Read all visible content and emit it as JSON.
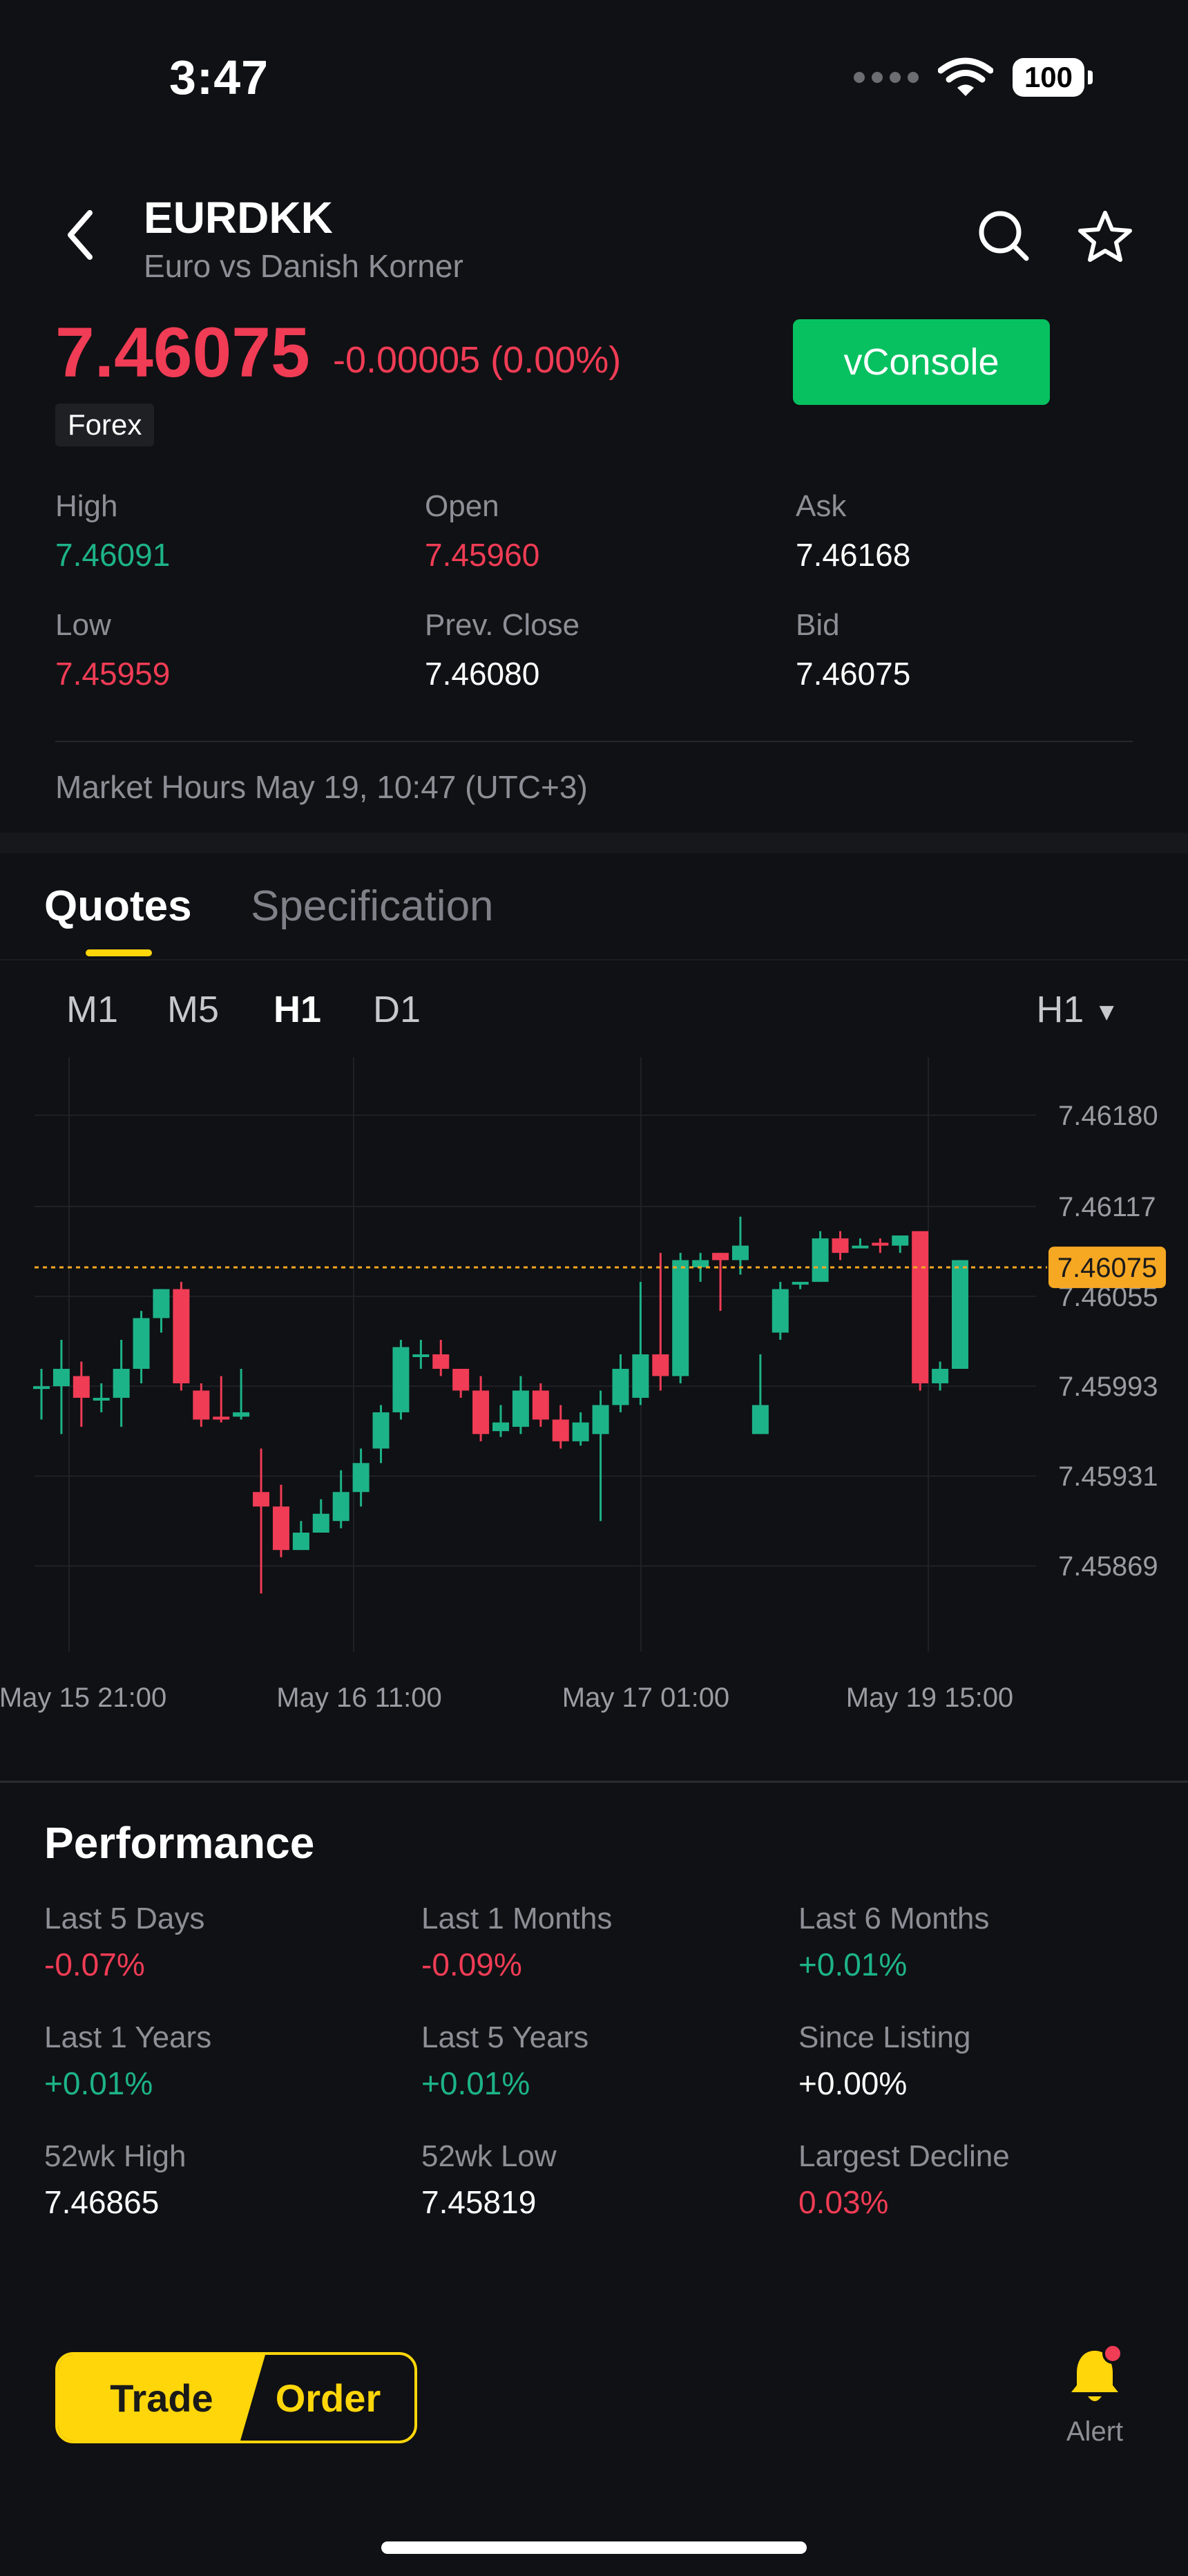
{
  "status_bar": {
    "time": "3:47",
    "battery": "100"
  },
  "header": {
    "symbol": "EURDKK",
    "subtitle": "Euro vs Danish Korner"
  },
  "quote": {
    "price": "7.46075",
    "change": "-0.00005 (0.00%)",
    "tag": "Forex",
    "vconsole_label": "vConsole"
  },
  "stats": [
    {
      "label": "High",
      "value": "7.46091",
      "tone": "green"
    },
    {
      "label": "Open",
      "value": "7.45960",
      "tone": "red"
    },
    {
      "label": "Ask",
      "value": "7.46168",
      "tone": "white"
    },
    {
      "label": "Low",
      "value": "7.45959",
      "tone": "red"
    },
    {
      "label": "Prev. Close",
      "value": "7.46080",
      "tone": "white"
    },
    {
      "label": "Bid",
      "value": "7.46075",
      "tone": "white"
    }
  ],
  "market_hours": "Market Hours May 19, 10:47 (UTC+3)",
  "tabs": [
    "Quotes",
    "Specification"
  ],
  "timeframes": [
    "M1",
    "M5",
    "H1",
    "D1"
  ],
  "active_timeframe": "H1",
  "timeframe_select": "H1",
  "chart_data": {
    "type": "candlestick",
    "y_ticks": [
      "7.46180",
      "7.46117",
      "7.46055",
      "7.45993",
      "7.45931",
      "7.45869"
    ],
    "x_ticks": [
      "May 15 21:00",
      "May 16 11:00",
      "May 17 01:00",
      "May 19 15:00"
    ],
    "current_price_label": "7.46075",
    "current_price": 7.46075,
    "ylim": [
      7.4581,
      7.4622
    ],
    "up_color": "#1db389",
    "down_color": "#f03c55",
    "candles": [
      [
        7.45993,
        7.45993,
        7.4597,
        7.46005
      ],
      [
        7.45993,
        7.46005,
        7.4596,
        7.46025
      ],
      [
        7.46,
        7.45985,
        7.45965,
        7.4601
      ],
      [
        7.45985,
        7.45985,
        7.45975,
        7.45995
      ],
      [
        7.45985,
        7.46005,
        7.45965,
        7.46025
      ],
      [
        7.46005,
        7.4604,
        7.45995,
        7.46045
      ],
      [
        7.4604,
        7.4606,
        7.4603,
        7.4606
      ],
      [
        7.4606,
        7.45995,
        7.4599,
        7.46065
      ],
      [
        7.4599,
        7.4597,
        7.45965,
        7.45995
      ],
      [
        7.45972,
        7.4597,
        7.45968,
        7.46
      ],
      [
        7.45972,
        7.45975,
        7.4597,
        7.46005
      ],
      [
        7.4592,
        7.4591,
        7.4585,
        7.4595
      ],
      [
        7.4591,
        7.4588,
        7.45875,
        7.45925
      ],
      [
        7.4588,
        7.45892,
        7.4588,
        7.459
      ],
      [
        7.45892,
        7.45905,
        7.45895,
        7.45915
      ],
      [
        7.459,
        7.4592,
        7.45895,
        7.45935
      ],
      [
        7.4592,
        7.4594,
        7.4591,
        7.4595
      ],
      [
        7.4595,
        7.45975,
        7.4594,
        7.4598
      ],
      [
        7.45975,
        7.4602,
        7.4597,
        7.46025
      ],
      [
        7.46015,
        7.46015,
        7.46005,
        7.46025
      ],
      [
        7.46015,
        7.46005,
        7.46,
        7.46025
      ],
      [
        7.46005,
        7.4599,
        7.45985,
        7.46005
      ],
      [
        7.4599,
        7.4596,
        7.45955,
        7.46
      ],
      [
        7.45962,
        7.45968,
        7.45958,
        7.4598
      ],
      [
        7.45965,
        7.4599,
        7.4596,
        7.46
      ],
      [
        7.4599,
        7.4597,
        7.45965,
        7.45995
      ],
      [
        7.4597,
        7.45955,
        7.4595,
        7.4598
      ],
      [
        7.45955,
        7.45968,
        7.45952,
        7.45975
      ],
      [
        7.4596,
        7.4598,
        7.459,
        7.4599
      ],
      [
        7.4598,
        7.46005,
        7.45975,
        7.46015
      ],
      [
        7.45985,
        7.46015,
        7.4598,
        7.46065
      ],
      [
        7.46015,
        7.46,
        7.4599,
        7.46085
      ],
      [
        7.46,
        7.4608,
        7.45995,
        7.46085
      ],
      [
        7.46075,
        7.4608,
        7.46065,
        7.46085
      ],
      [
        7.46085,
        7.4608,
        7.46045,
        7.46085
      ],
      [
        7.4608,
        7.4609,
        7.4607,
        7.4611
      ],
      [
        7.4596,
        7.4598,
        7.4596,
        7.46015
      ],
      [
        7.4603,
        7.4606,
        7.46025,
        7.46065
      ],
      [
        7.46065,
        7.46065,
        7.4606,
        7.46065
      ],
      [
        7.46065,
        7.46095,
        7.46065,
        7.461
      ],
      [
        7.46095,
        7.46085,
        7.4608,
        7.461
      ],
      [
        7.4609,
        7.4609,
        7.4609,
        7.46095
      ],
      [
        7.46092,
        7.4609,
        7.46085,
        7.46095
      ],
      [
        7.4609,
        7.46097,
        7.46085,
        7.46097
      ],
      [
        7.461,
        7.45995,
        7.4599,
        7.461
      ],
      [
        7.45995,
        7.46005,
        7.4599,
        7.4601
      ],
      [
        7.46005,
        7.4608,
        7.46005,
        7.4608
      ]
    ]
  },
  "performance": {
    "title": "Performance",
    "items": [
      {
        "label": "Last 5 Days",
        "value": "-0.07%",
        "tone": "red"
      },
      {
        "label": "Last 1 Months",
        "value": "-0.09%",
        "tone": "red"
      },
      {
        "label": "Last 6 Months",
        "value": "+0.01%",
        "tone": "green"
      },
      {
        "label": "Last 1 Years",
        "value": "+0.01%",
        "tone": "green"
      },
      {
        "label": "Last 5 Years",
        "value": "+0.01%",
        "tone": "green"
      },
      {
        "label": "Since Listing",
        "value": "+0.00%",
        "tone": "white"
      },
      {
        "label": "52wk High",
        "value": "7.46865",
        "tone": "white"
      },
      {
        "label": "52wk Low",
        "value": "7.45819",
        "tone": "white"
      },
      {
        "label": "Largest Decline",
        "value": "0.03%",
        "tone": "red"
      }
    ]
  },
  "bottom": {
    "trade": "Trade",
    "order": "Order",
    "alert": "Alert"
  }
}
